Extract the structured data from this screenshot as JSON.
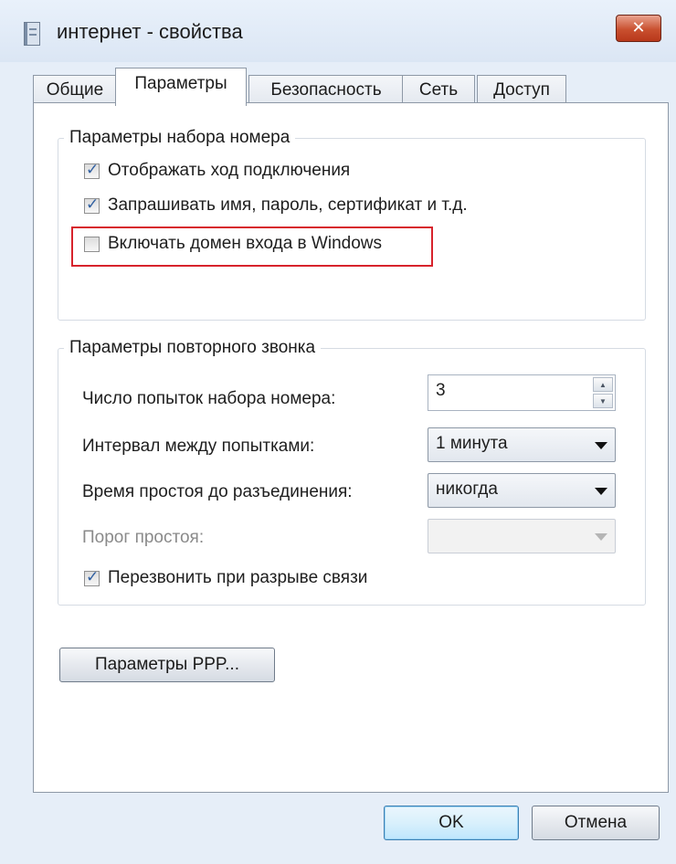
{
  "window": {
    "title": "интернет - свойства",
    "close_label": "✕"
  },
  "tabs": [
    {
      "label": "Общие",
      "active": false
    },
    {
      "label": "Параметры",
      "active": true
    },
    {
      "label": "Безопасность",
      "active": false
    },
    {
      "label": "Сеть",
      "active": false
    },
    {
      "label": "Доступ",
      "active": false
    }
  ],
  "dial_group": {
    "title": "Параметры набора номера",
    "items": [
      {
        "label": "Отображать ход подключения",
        "checked": true
      },
      {
        "label": "Запрашивать имя, пароль, сертификат и т.д.",
        "checked": true
      },
      {
        "label": "Включать домен входа в Windows",
        "checked": false
      }
    ]
  },
  "redial_group": {
    "title": "Параметры повторного звонка",
    "attempts_label": "Число попыток набора номера:",
    "attempts_value": "3",
    "interval_label": "Интервал между попытками:",
    "interval_value": "1 минута",
    "idle_label": "Время простоя до разъединения:",
    "idle_value": "никогда",
    "threshold_label": "Порог простоя:",
    "threshold_value": "",
    "redial_label": "Перезвонить при разрыве связи",
    "redial_checked": true
  },
  "ppp_button": "Параметры PPP...",
  "buttons": {
    "ok": "OK",
    "cancel": "Отмена"
  },
  "colors": {
    "highlight": "#d7232c",
    "accent": "#3c7fb1"
  }
}
